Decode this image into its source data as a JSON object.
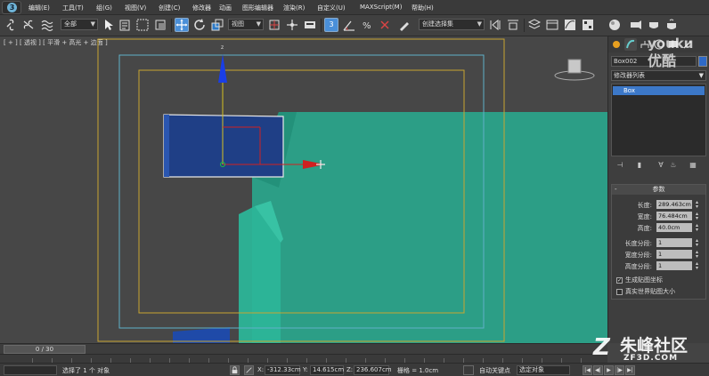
{
  "menubar": {
    "items": [
      "编辑(E)",
      "工具(T)",
      "组(G)",
      "视图(V)",
      "创建(C)",
      "修改器",
      "动画",
      "图形编辑器",
      "渲染(R)",
      "自定义(U)",
      "MAXScript(M)",
      "帮助(H)"
    ]
  },
  "toolbar": {
    "selection_filter": "全部",
    "coord_system": "视图",
    "named_selection": "创建选择集",
    "snap_label": "3"
  },
  "viewport": {
    "label": "[ + ] [ 透视 ] [ 平滑 + 高光 + 边面 ]",
    "axis_y_label": "z",
    "colors": {
      "safe_frame": "#c8a630",
      "action_frame": "#5fb0c8",
      "box_selected": "#1f3f86",
      "teal_object": "#2aa68c",
      "gizmo_z": "#1a3ee6",
      "gizmo_x": "#d02020"
    }
  },
  "command_panel": {
    "object_name": "Box002",
    "modifier_list": "修改器列表",
    "stack_item": "Box",
    "params_title": "参数",
    "params": [
      {
        "label": "长度:",
        "value": "289.463cm"
      },
      {
        "label": "宽度:",
        "value": "76.484cm"
      },
      {
        "label": "高度:",
        "value": "40.0cm"
      }
    ],
    "segments": [
      {
        "label": "长度分段:",
        "value": "1"
      },
      {
        "label": "宽度分段:",
        "value": "1"
      },
      {
        "label": "高度分段:",
        "value": "1"
      }
    ],
    "checkboxes": [
      {
        "label": "生成贴图坐标",
        "checked": "✓"
      },
      {
        "label": "真实世界贴图大小",
        "checked": ""
      }
    ]
  },
  "timeline": {
    "frame": "0 / 30"
  },
  "status": {
    "selected": "选择了 1 个 对象",
    "x_label": "X:",
    "x": "-312.33cm",
    "y_label": "Y:",
    "y": "14.615cm",
    "z_label": "Z:",
    "z": "236.607cm",
    "grid": "栅格 = 1.0cm",
    "auto_key": "自动关键点",
    "set_key": "选定对象"
  },
  "watermarks": {
    "youku": "youku",
    "youku_cn": "优酷",
    "site_cn": "朱峰社区",
    "site_url": "ZF3D.COM",
    "site_logo": "Z"
  }
}
